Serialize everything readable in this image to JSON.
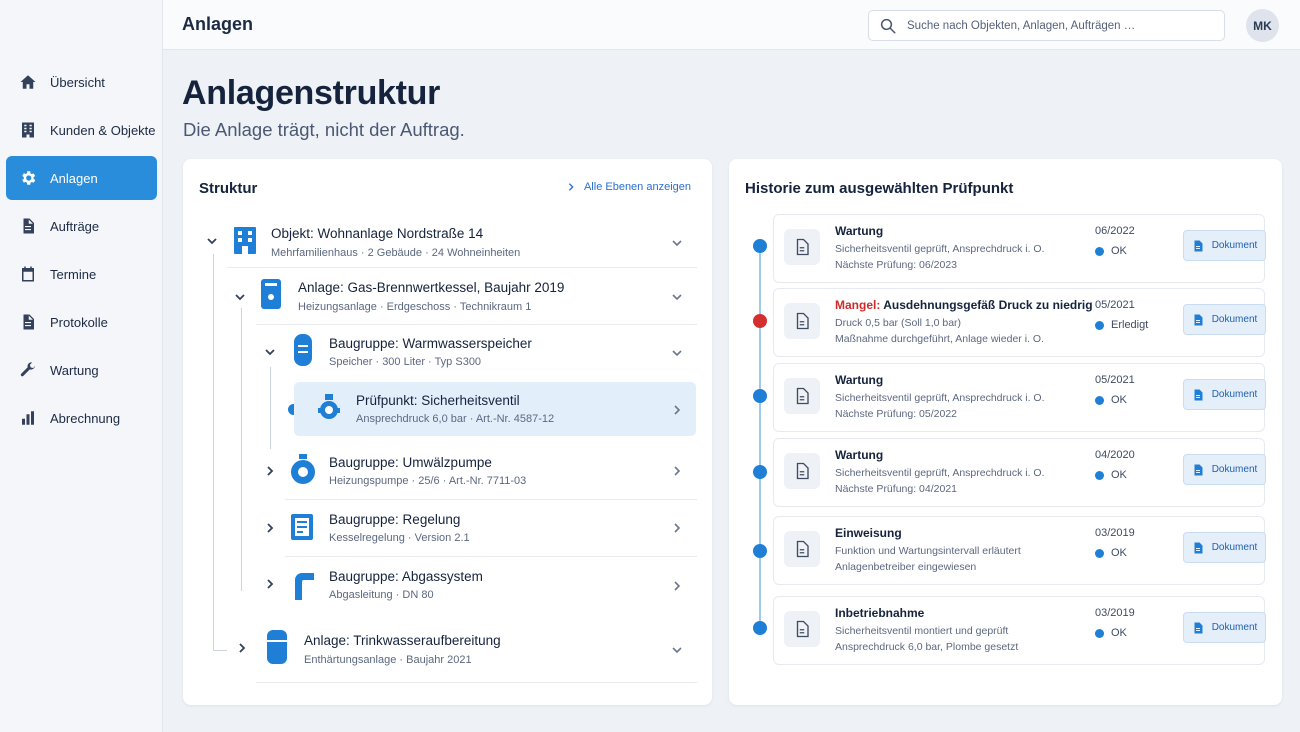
{
  "app": {
    "title": "Anlagen"
  },
  "search": {
    "placeholder": "Suche nach Objekten, Anlagen, Aufträgen …"
  },
  "user": {
    "initials": "MK"
  },
  "sidebar": {
    "items": [
      {
        "label": "Übersicht",
        "icon": "home-icon",
        "active": false
      },
      {
        "label": "Kunden & Objekte",
        "icon": "building-icon",
        "active": false
      },
      {
        "label": "Anlagen",
        "icon": "gear-icon",
        "active": true
      },
      {
        "label": "Aufträge",
        "icon": "document-icon",
        "active": false
      },
      {
        "label": "Termine",
        "icon": "calendar-icon",
        "active": false
      },
      {
        "label": "Protokolle",
        "icon": "document-icon",
        "active": false
      },
      {
        "label": "Wartung",
        "icon": "wrench-icon",
        "active": false
      },
      {
        "label": "Abrechnung",
        "icon": "bar-chart-icon",
        "active": false
      }
    ]
  },
  "page": {
    "title": "Anlagenstruktur",
    "subtitle": "Die Anlage trägt, nicht der Auftrag."
  },
  "structure": {
    "title": "Struktur",
    "show_all_levels": "Alle Ebenen anzeigen",
    "nodes": [
      {
        "title": "Objekt: Wohnanlage Nordstraße 14",
        "subtitle": "Mehrfamilienhaus · 2 Gebäude · 24 Wohneinheiten",
        "icon": "building-icon",
        "expanded": true
      },
      {
        "title": "Anlage: Gas-Brennwertkessel, Baujahr 2019",
        "subtitle": "Heizungsanlage · Erdgeschoss · Technikraum 1",
        "icon": "boiler-icon",
        "expanded": true
      },
      {
        "title": "Baugruppe: Warmwasserspeicher",
        "subtitle": "Speicher · 300 Liter · Typ S300",
        "icon": "tank-icon",
        "expanded": true
      },
      {
        "title": "Prüfpunkt: Sicherheitsventil",
        "subtitle": "Ansprechdruck 6,0 bar · Art.-Nr. 4587-12",
        "icon": "valve-icon",
        "selected": true
      },
      {
        "title": "Baugruppe: Umwälzpumpe",
        "subtitle": "Heizungspumpe · 25/6 · Art.-Nr. 7711-03",
        "icon": "pump-icon",
        "expanded": false
      },
      {
        "title": "Baugruppe: Regelung",
        "subtitle": "Kesselregelung · Version 2.1",
        "icon": "controller-icon",
        "expanded": false
      },
      {
        "title": "Baugruppe: Abgassystem",
        "subtitle": "Abgasleitung · DN 80",
        "icon": "flue-pipe-icon",
        "expanded": false
      },
      {
        "title": "Anlage: Trinkwasseraufbereitung",
        "subtitle": "Enthärtungsanlage · Baujahr 2021",
        "icon": "cylinder-icon",
        "expanded": false
      }
    ]
  },
  "history": {
    "title": "Historie zum ausgewählten Prüfpunkt",
    "doc_label": "Dokument",
    "entries": [
      {
        "prefix": "",
        "title": "Wartung",
        "line1": "Sicherheitsventil geprüft, Ansprechdruck i. O.",
        "line2": "Nächste Prüfung: 06/2023",
        "date": "06/2022",
        "status": "OK",
        "dot_color": "#1f7fd6"
      },
      {
        "prefix": "Mangel:",
        "title": "Ausdehnungsgefäß Druck zu niedrig",
        "line1": "Druck 0,5 bar (Soll 1,0 bar)",
        "line2": "Maßnahme durchgeführt, Anlage wieder i. O.",
        "date": "05/2021",
        "status": "Erledigt",
        "dot_color": "#d32f2f"
      },
      {
        "prefix": "",
        "title": "Wartung",
        "line1": "Sicherheitsventil geprüft, Ansprechdruck i. O.",
        "line2": "Nächste Prüfung: 05/2022",
        "date": "05/2021",
        "status": "OK",
        "dot_color": "#1f7fd6"
      },
      {
        "prefix": "",
        "title": "Wartung",
        "line1": "Sicherheitsventil geprüft, Ansprechdruck i. O.",
        "line2": "Nächste Prüfung: 04/2021",
        "date": "04/2020",
        "status": "OK",
        "dot_color": "#1f7fd6"
      },
      {
        "prefix": "",
        "title": "Einweisung",
        "line1": "Funktion und Wartungsintervall erläutert",
        "line2": "Anlagenbetreiber eingewiesen",
        "date": "03/2019",
        "status": "OK",
        "dot_color": "#1f7fd6"
      },
      {
        "prefix": "",
        "title": "Inbetriebnahme",
        "line1": "Sicherheitsventil montiert und geprüft",
        "line2": "Ansprechdruck 6,0 bar, Plombe gesetzt",
        "date": "03/2019",
        "status": "OK",
        "dot_color": "#1f7fd6"
      }
    ]
  },
  "colors": {
    "accent": "#2a8ddb",
    "primary_blue": "#1f7fd6",
    "defect_red": "#d02b2b",
    "selected_row": "#e3eefb"
  }
}
